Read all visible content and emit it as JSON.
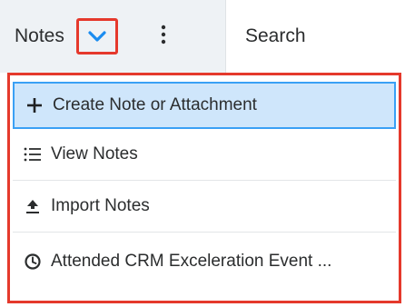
{
  "topbar": {
    "tab_label": "Notes",
    "dropdown_icon": "chevron-down-icon",
    "more_icon": "kebab-icon",
    "search_label": "Search"
  },
  "menu": {
    "items": [
      {
        "label": "Create Note or Attachment",
        "icon": "plus-icon"
      },
      {
        "label": "View Notes",
        "icon": "list-icon"
      },
      {
        "label": "Import Notes",
        "icon": "upload-icon"
      },
      {
        "label": "Attended CRM Exceleration Event ...",
        "icon": "clock-icon"
      }
    ]
  },
  "colors": {
    "highlight_border": "#e5392c",
    "selected_bg": "#cfe6fb",
    "selected_border": "#3aa0f5",
    "chevron": "#1a8cf0"
  }
}
